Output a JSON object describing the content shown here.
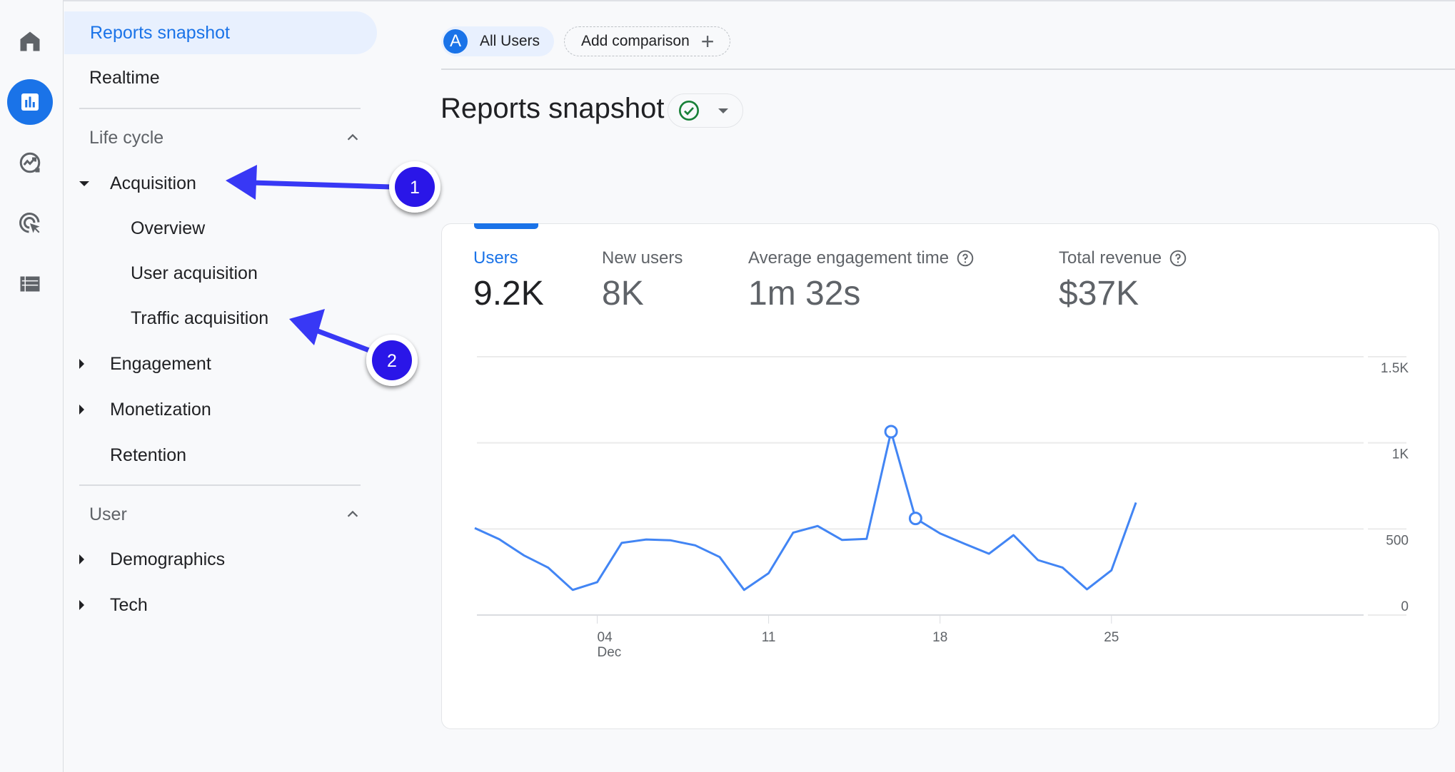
{
  "rail": {
    "items": [
      {
        "name": "home",
        "icon": "home-icon",
        "active": false
      },
      {
        "name": "reports",
        "icon": "bar-chart-icon",
        "active": true
      },
      {
        "name": "explore",
        "icon": "explore-icon",
        "active": false
      },
      {
        "name": "advertising",
        "icon": "ads-target-icon",
        "active": false
      },
      {
        "name": "configure",
        "icon": "list-icon",
        "active": false
      }
    ]
  },
  "nav": {
    "reports_snapshot": "Reports snapshot",
    "realtime": "Realtime",
    "lifecycle": {
      "title": "Life cycle",
      "acquisition": "Acquisition",
      "overview": "Overview",
      "user_acquisition": "User acquisition",
      "traffic_acquisition": "Traffic acquisition",
      "engagement": "Engagement",
      "monetization": "Monetization",
      "retention": "Retention"
    },
    "user": {
      "title": "User",
      "demographics": "Demographics",
      "tech": "Tech"
    }
  },
  "header": {
    "segment_avatar": "A",
    "segment_label": "All Users",
    "add_comparison": "Add comparison",
    "add_icon": "+"
  },
  "page": {
    "title": "Reports snapshot"
  },
  "metrics": [
    {
      "label": "Users",
      "value": "9.2K",
      "active": true,
      "help": false
    },
    {
      "label": "New users",
      "value": "8K",
      "active": false,
      "help": false
    },
    {
      "label": "Average engagement time",
      "value": "1m 32s",
      "active": false,
      "help": true
    },
    {
      "label": "Total revenue",
      "value": "$37K",
      "active": false,
      "help": true
    }
  ],
  "annotations": [
    {
      "number": "1",
      "target": "Acquisition"
    },
    {
      "number": "2",
      "target": "Traffic acquisition"
    }
  ],
  "colors": {
    "accent": "#1a73e8",
    "line": "#4285f4",
    "annotation": "#2a13e8",
    "arrow": "#3838f5",
    "success": "#188038"
  },
  "chart_data": {
    "type": "line",
    "title": "",
    "xlabel": "",
    "ylabel": "",
    "x": [
      "Nov 29",
      "Nov 30",
      "Dec 1",
      "Dec 2",
      "Dec 3",
      "Dec 4",
      "Dec 5",
      "Dec 6",
      "Dec 7",
      "Dec 8",
      "Dec 9",
      "Dec 10",
      "Dec 11",
      "Dec 12",
      "Dec 13",
      "Dec 14",
      "Dec 15",
      "Dec 16",
      "Dec 17",
      "Dec 18",
      "Dec 19",
      "Dec 20",
      "Dec 21",
      "Dec 22",
      "Dec 23",
      "Dec 24",
      "Dec 25",
      "Dec 26"
    ],
    "series": [
      {
        "name": "Users",
        "values": [
          505,
          440,
          347,
          275,
          146,
          191,
          419,
          439,
          434,
          405,
          337,
          146,
          243,
          478,
          517,
          436,
          442,
          1065,
          561,
          474,
          414,
          356,
          464,
          319,
          276,
          149,
          260,
          653
        ]
      }
    ],
    "highlighted_points": [
      "Dec 16",
      "Dec 17"
    ],
    "x_ticks": [
      {
        "label": "04",
        "sublabel": "Dec",
        "index": 5
      },
      {
        "label": "11",
        "sublabel": "",
        "index": 12
      },
      {
        "label": "18",
        "sublabel": "",
        "index": 19
      },
      {
        "label": "25",
        "sublabel": "",
        "index": 26
      }
    ],
    "y_ticks": [
      {
        "value": 0,
        "label": "0"
      },
      {
        "value": 500,
        "label": "500"
      },
      {
        "value": 1000,
        "label": "1K"
      },
      {
        "value": 1500,
        "label": "1.5K"
      }
    ],
    "ylim": [
      0,
      1500
    ],
    "y_axis_position": "right",
    "grid": true,
    "legend": "none"
  }
}
